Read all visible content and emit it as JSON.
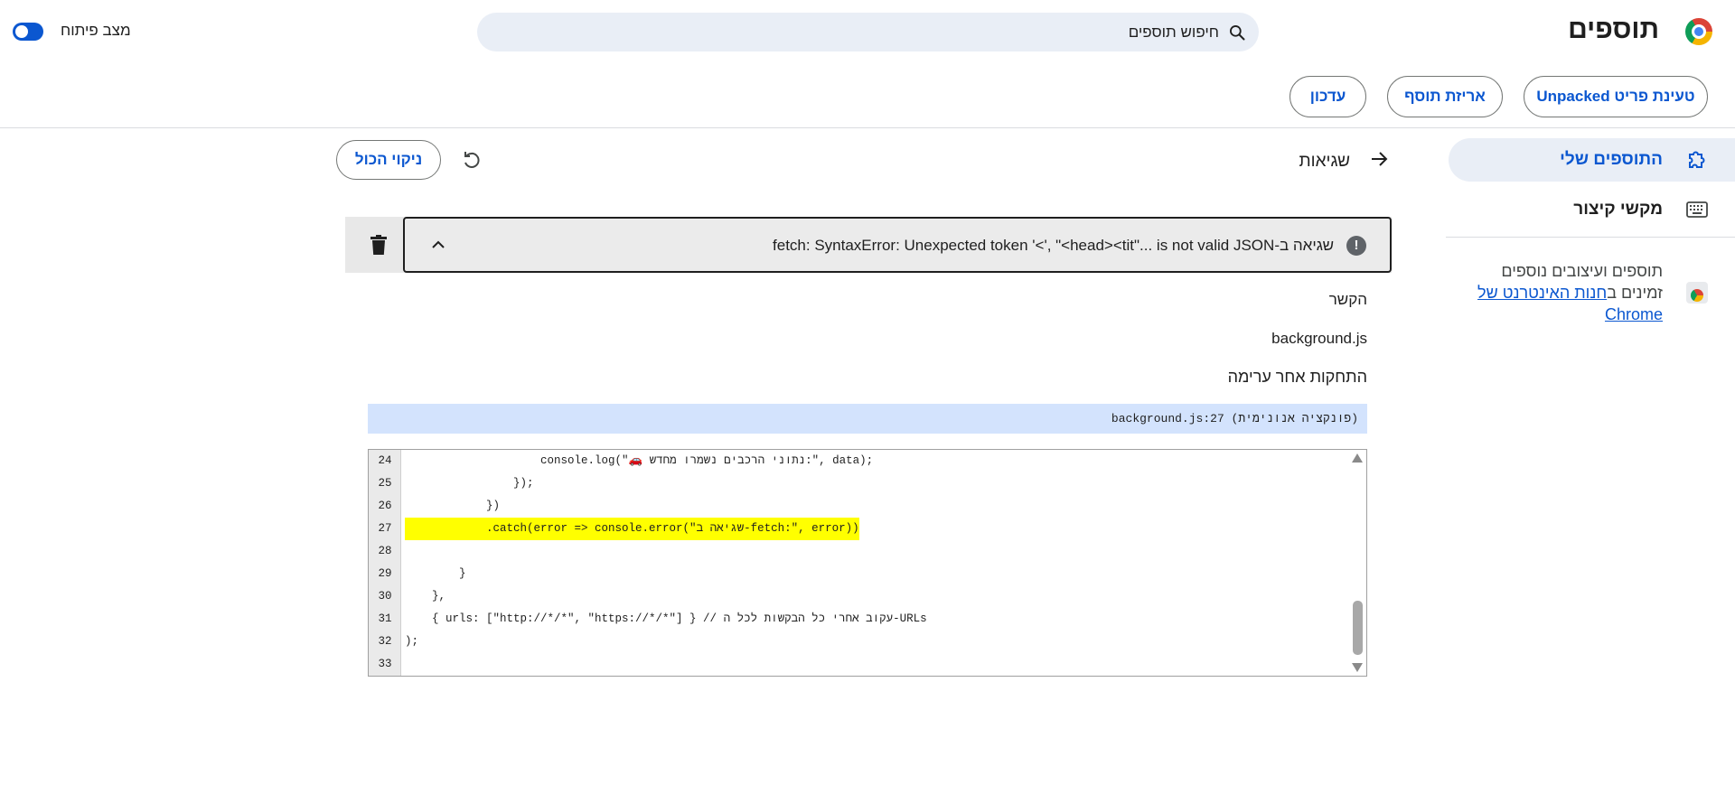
{
  "header": {
    "title": "תוספים",
    "search_placeholder": "חיפוש תוספים",
    "dev_mode_label": "מצב פיתוח"
  },
  "toolbar": {
    "load_unpacked": "טעינת פריט Unpacked",
    "pack_extension": "אריזת תוסף",
    "update": "עדכון"
  },
  "sidebar": {
    "items": [
      {
        "label": "התוספים שלי",
        "icon": "puzzle-icon",
        "selected": true
      },
      {
        "label": "מקשי קיצור",
        "icon": "keyboard-icon",
        "selected": false
      }
    ],
    "store_text_prefix": "תוספים ועיצובים נוספים זמינים ב",
    "store_link": "חנות האינטרנט של Chrome"
  },
  "errors": {
    "title": "שגיאות",
    "clear_all": "ניקוי הכול",
    "message": "שגיאה ב-fetch: SyntaxError: Unexpected token '<', \"<head><tit\"... is not valid JSON",
    "context_heading": "הקשר",
    "context_value": "background.js",
    "stack_heading": "התחקות אחר ערימה",
    "stack_frame": "background.js:27 (פונקציה אנונימית)"
  },
  "code": {
    "lines": [
      {
        "num": "24",
        "text": "                    console.log(\"🚗 נתוני הרכבים נשמרו מחדש:\", data);",
        "highlight": false
      },
      {
        "num": "25",
        "text": "                });",
        "highlight": false
      },
      {
        "num": "26",
        "text": "            })",
        "highlight": false
      },
      {
        "num": "27",
        "text": "            .catch(error => console.error(\"שגיאה ב-fetch:\", error))",
        "highlight": true
      },
      {
        "num": "28",
        "text": "",
        "highlight": false
      },
      {
        "num": "29",
        "text": "        }",
        "highlight": false
      },
      {
        "num": "30",
        "text": "    },",
        "highlight": false
      },
      {
        "num": "31",
        "text": "    { urls: [\"http://*/*\", \"https://*/*\"] } // עקוב אחרי כל הבקשות לכל ה-URLs",
        "highlight": false
      },
      {
        "num": "32",
        "text": ");",
        "highlight": false
      },
      {
        "num": "33",
        "text": "",
        "highlight": false
      }
    ]
  },
  "colors": {
    "accent": "#0b57d0",
    "highlight": "#ffff00",
    "selected_nav": "#e9eef6"
  }
}
